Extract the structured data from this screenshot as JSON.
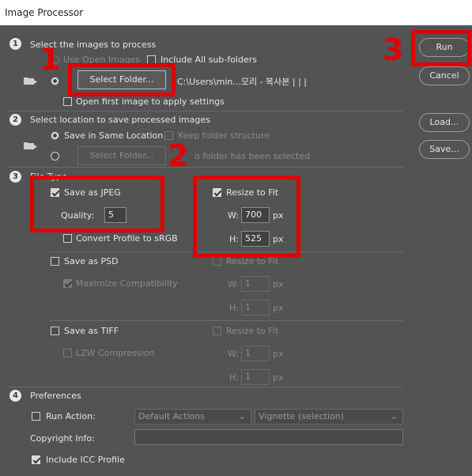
{
  "window": {
    "title": "Image Processor"
  },
  "section1": {
    "number": "1",
    "title": "Select the images to process",
    "use_open_images": "Use Open Images",
    "include_subfolders": "Include All sub-folders",
    "select_folder_btn": "Select Folder...",
    "path": "C:\\Users\\min...모리 - 복사본 | | |",
    "open_first_image": "Open first image to apply settings"
  },
  "section2": {
    "number": "2",
    "title": "Select location to save processed images",
    "save_same_location": "Save in Same Location",
    "keep_folder_structure": "Keep folder structure",
    "select_folder_btn": "Select Folder...",
    "no_folder_text": "o folder has been selected"
  },
  "section3": {
    "number": "3",
    "title": "File Type",
    "jpeg": {
      "label": "Save as JPEG",
      "quality_label": "Quality:",
      "quality": "5",
      "convert_profile": "Convert Profile to sRGB",
      "resize": "Resize to Fit",
      "w_label": "W:",
      "w": "700",
      "h_label": "H:",
      "h": "525",
      "unit": "px"
    },
    "psd": {
      "label": "Save as PSD",
      "maximize": "Maximize Compatibility",
      "resize": "Resize to Fit",
      "w_label": "W:",
      "w": "1",
      "h_label": "H:",
      "h": "1",
      "unit": "px"
    },
    "tiff": {
      "label": "Save as TIFF",
      "lzw": "LZW Compression",
      "resize": "Resize to Fit",
      "w_label": "W:",
      "w": "1",
      "h_label": "H:",
      "h": "1",
      "unit": "px"
    }
  },
  "section4": {
    "number": "4",
    "title": "Preferences",
    "run_action": "Run Action:",
    "action_set": "Default Actions",
    "action": "Vignette (selection)",
    "copyright_label": "Copyright Info:",
    "copyright_value": "",
    "include_icc": "Include ICC Profile"
  },
  "buttons": {
    "run": "Run",
    "cancel": "Cancel",
    "load": "Load...",
    "save": "Save..."
  },
  "annotations": {
    "one": "1",
    "two": "2",
    "three": "3"
  },
  "icons": {
    "dropdown": "chevron-down-icon",
    "folder": "folder-arrow-icon"
  },
  "colors": {
    "highlight": "#e00000",
    "background": "#535353"
  }
}
